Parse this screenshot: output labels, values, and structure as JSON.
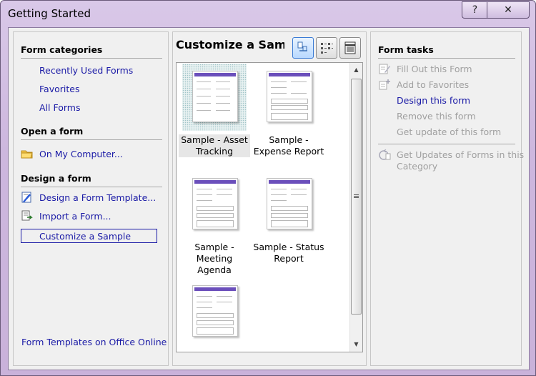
{
  "window": {
    "title": "Getting Started",
    "help_label": "?",
    "close_label": "✕"
  },
  "left": {
    "categories_heading": "Form categories",
    "categories": [
      "Recently Used Forms",
      "Favorites",
      "All Forms"
    ],
    "open_heading": "Open a form",
    "open_items": [
      {
        "label": "On My Computer...",
        "icon": "folder-icon"
      }
    ],
    "design_heading": "Design a form",
    "design_items": [
      {
        "label": "Design a Form Template...",
        "icon": "design-template-icon"
      },
      {
        "label": "Import a Form...",
        "icon": "import-form-icon"
      }
    ],
    "selected_item": "Customize a Sample",
    "footer_link": "Form Templates on Office Online"
  },
  "middle": {
    "title": "Customize a Sample",
    "view_buttons": [
      {
        "name": "large-icons-view-icon",
        "active": true
      },
      {
        "name": "list-view-icon",
        "active": false
      },
      {
        "name": "details-view-icon",
        "active": false
      }
    ],
    "thumbnails": [
      {
        "caption_line1": "Sample - Asset",
        "caption_line2": "Tracking",
        "selected": true,
        "header": "My Form"
      },
      {
        "caption_line1": "Sample -",
        "caption_line2": "Expense Report",
        "selected": false,
        "header": "My Form"
      },
      {
        "caption_line1": "Sample -",
        "caption_line2": "Meeting Agenda",
        "selected": false,
        "header": "My Form"
      },
      {
        "caption_line1": "Sample - Status",
        "caption_line2": "Report",
        "selected": false,
        "header": "My Form"
      },
      {
        "caption_line1": "",
        "caption_line2": "",
        "selected": false,
        "header": "My Form"
      }
    ]
  },
  "right": {
    "heading": "Form tasks",
    "tasks": [
      {
        "label": "Fill Out this Form",
        "enabled": false,
        "icon": "fill-form-icon"
      },
      {
        "label": "Add to Favorites",
        "enabled": false,
        "icon": "add-favorites-icon"
      },
      {
        "label": "Design this form",
        "enabled": true,
        "icon": ""
      },
      {
        "label": "Remove this form",
        "enabled": false,
        "icon": ""
      },
      {
        "label": "Get update of this form",
        "enabled": false,
        "icon": ""
      }
    ],
    "updates_line1": "Get Updates of Forms in this",
    "updates_line2": "Category",
    "updates_icon": "update-forms-icon"
  },
  "colors": {
    "link": "#1a1aa6",
    "disabled": "#a0a0a0",
    "accent": "#6b4fbb",
    "frame": "#cdb7de"
  }
}
